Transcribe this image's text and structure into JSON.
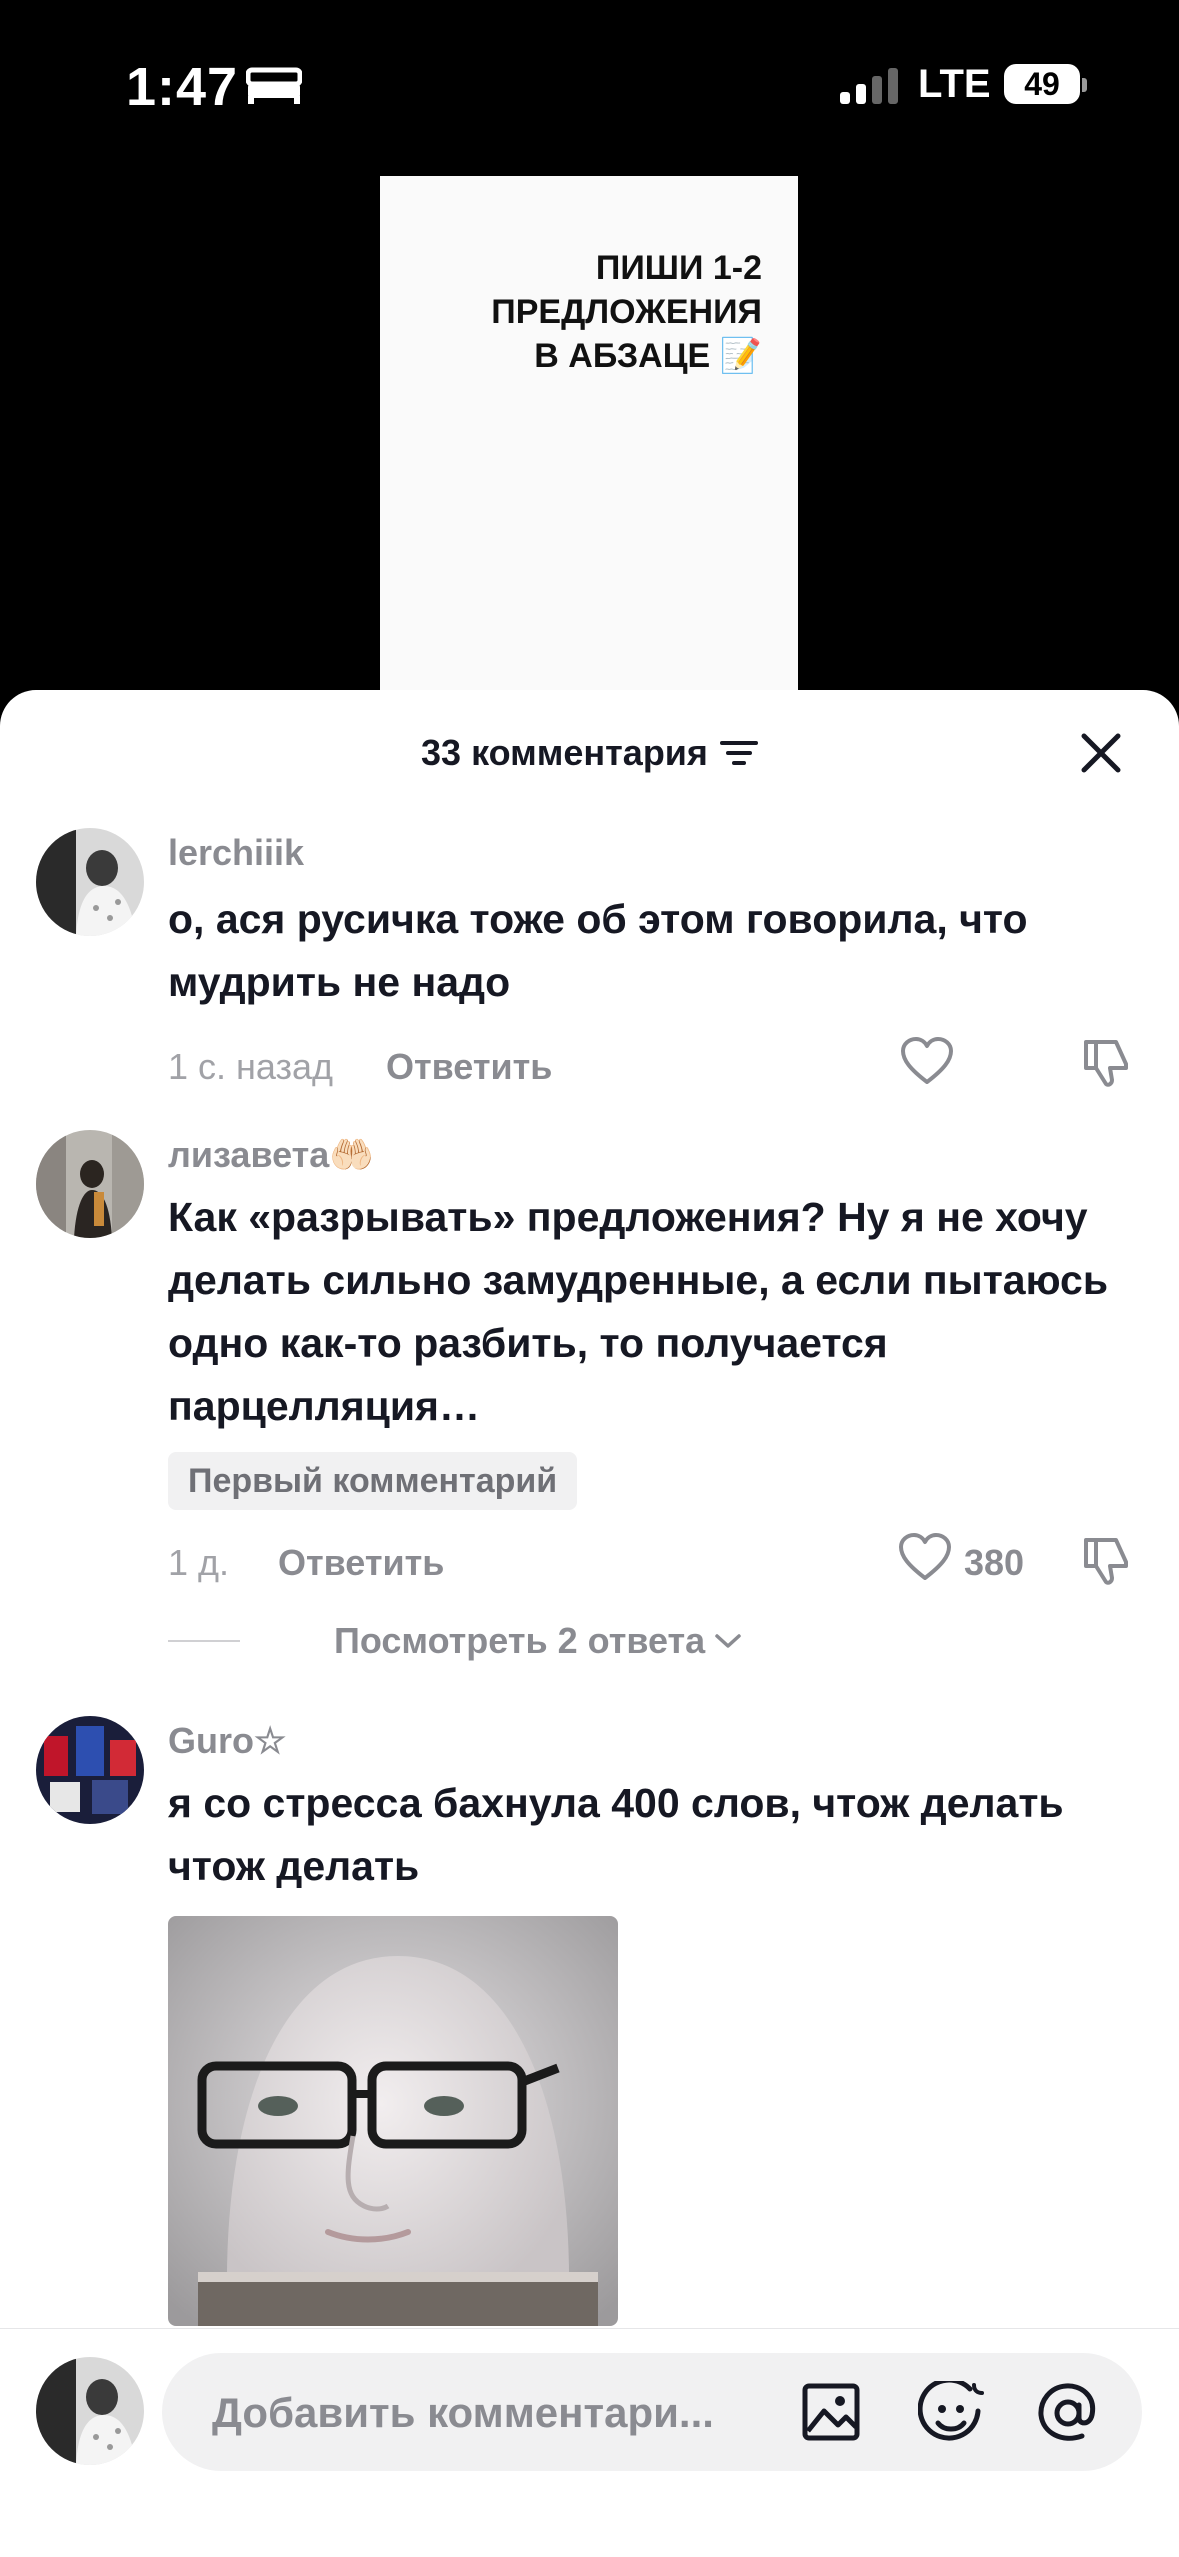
{
  "status": {
    "time": "1:47",
    "network": "LTE",
    "battery": "49"
  },
  "video": {
    "lines": [
      "ПИШИ 1-2",
      "ПРЕДЛОЖЕНИЯ",
      "В АБЗАЦЕ 📝"
    ]
  },
  "sheet": {
    "title": "33 комментария"
  },
  "comments": [
    {
      "username": "lerchiiik",
      "text": "о, ася русичка тоже об этом говорила, что мудрить не надо",
      "time": "1 с. назад",
      "reply_label": "Ответить"
    },
    {
      "username": "лизавета🤲🏻",
      "text": "Как «разрывать» предложения? Ну я не хочу делать сильно замудренные, а если пытаюсь одно как-то разбить, то получается парцелляция…",
      "badge": "Первый комментарий",
      "time": "1 д.",
      "reply_label": "Ответить",
      "likes": "380",
      "view_replies": "Посмотреть 2 ответа"
    },
    {
      "username": "Guro☆",
      "text": "я со стресса бахнула 400 слов, чтож делать чтож делать"
    }
  ],
  "input": {
    "placeholder": "Добавить комментари..."
  },
  "icons": {
    "sleep": "bed-icon",
    "signal": "signal-icon",
    "filter": "filter-icon",
    "close": "close-icon",
    "like": "heart-icon",
    "dislike": "thumbs-down-icon",
    "chevron": "chevron-down-icon",
    "image": "image-icon",
    "emoji": "emoji-icon",
    "mention": "at-icon"
  },
  "colors": {
    "text": "#161823",
    "secondary": "#8a8b91",
    "sheet": "#ffffff",
    "input": "#f1f1f2"
  }
}
